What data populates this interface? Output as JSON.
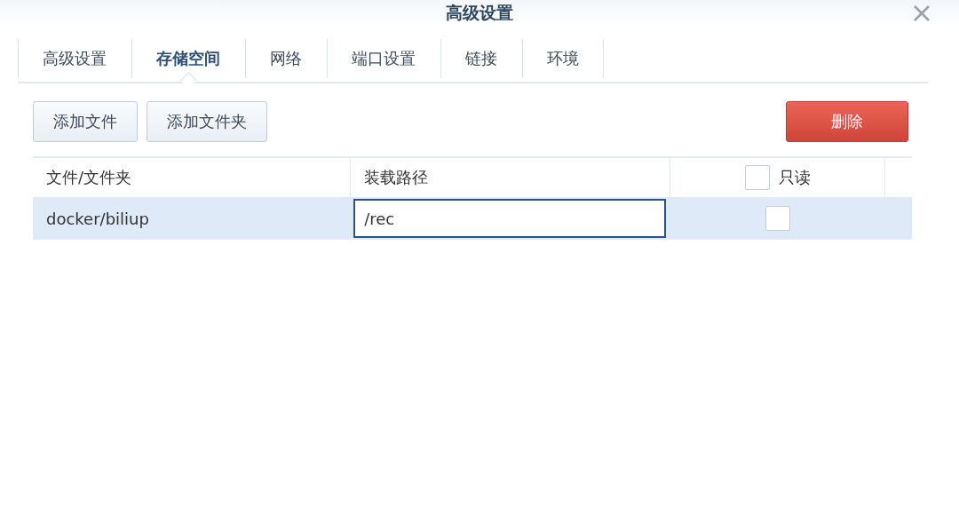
{
  "window": {
    "title": "高级设置"
  },
  "tabs": [
    {
      "label": "高级设置",
      "selected": false
    },
    {
      "label": "存储空间",
      "selected": true
    },
    {
      "label": "网络",
      "selected": false
    },
    {
      "label": "端口设置",
      "selected": false
    },
    {
      "label": "链接",
      "selected": false
    },
    {
      "label": "环境",
      "selected": false
    }
  ],
  "toolbar": {
    "buttons": [
      "添加文件",
      "添加文件夹"
    ],
    "delete_button": "删除"
  },
  "table": {
    "columns": [
      "文件/文件夹",
      "装载路径"
    ],
    "readonly_header": {
      "label": "只读",
      "checked": false
    },
    "rows": [
      {
        "path": "docker/biliup",
        "mount": "/rec",
        "readonly": false,
        "selected": true
      }
    ]
  }
}
